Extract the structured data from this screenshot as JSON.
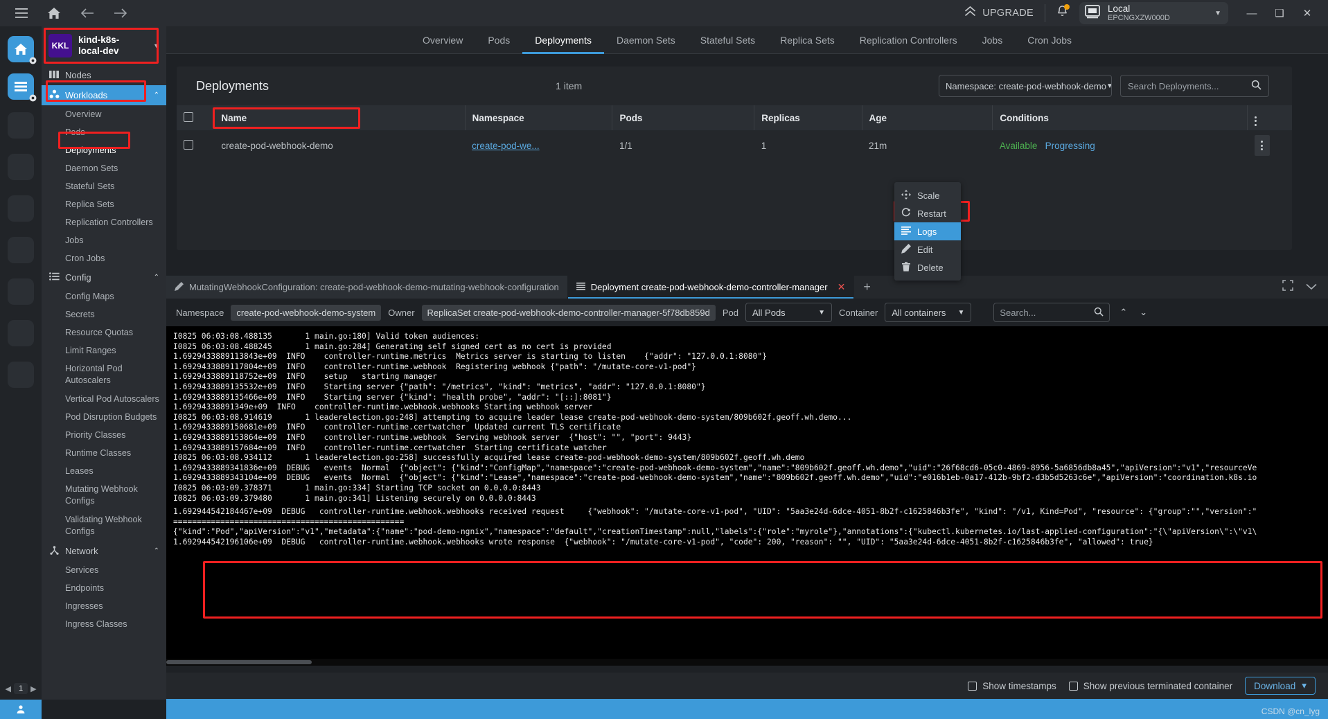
{
  "window": {
    "upgrade_label": "UPGRADE",
    "cluster_pill": {
      "name": "Local",
      "subtitle": "EPCNGXZW000D"
    },
    "controls": {
      "minimize": "—",
      "maximize": "❑",
      "close": "✕"
    }
  },
  "rail": {
    "page_number": "1",
    "prev": "◀",
    "next": "▶"
  },
  "sidebar": {
    "context": {
      "badge": "KKL",
      "name": "kind-k8s-local-dev"
    },
    "items": [
      {
        "label": "Nodes",
        "type": "group",
        "icon": "nodes-icon"
      },
      {
        "label": "Workloads",
        "type": "group",
        "icon": "workloads-icon",
        "selected": true,
        "chevron": "⌃"
      },
      {
        "label": "Overview",
        "type": "item"
      },
      {
        "label": "Pods",
        "type": "item"
      },
      {
        "label": "Deployments",
        "type": "item",
        "highlighted": true
      },
      {
        "label": "Daemon Sets",
        "type": "item"
      },
      {
        "label": "Stateful Sets",
        "type": "item"
      },
      {
        "label": "Replica Sets",
        "type": "item"
      },
      {
        "label": "Replication Controllers",
        "type": "item"
      },
      {
        "label": "Jobs",
        "type": "item"
      },
      {
        "label": "Cron Jobs",
        "type": "item"
      },
      {
        "label": "Config",
        "type": "group",
        "icon": "config-icon",
        "chevron": "⌃"
      },
      {
        "label": "Config Maps",
        "type": "item"
      },
      {
        "label": "Secrets",
        "type": "item"
      },
      {
        "label": "Resource Quotas",
        "type": "item"
      },
      {
        "label": "Limit Ranges",
        "type": "item"
      },
      {
        "label": "Horizontal Pod Autoscalers",
        "type": "item",
        "two_line": true
      },
      {
        "label": "Vertical Pod Autoscalers",
        "type": "item"
      },
      {
        "label": "Pod Disruption Budgets",
        "type": "item"
      },
      {
        "label": "Priority Classes",
        "type": "item"
      },
      {
        "label": "Runtime Classes",
        "type": "item"
      },
      {
        "label": "Leases",
        "type": "item"
      },
      {
        "label": "Mutating Webhook Configs",
        "type": "item",
        "two_line": true
      },
      {
        "label": "Validating Webhook Configs",
        "type": "item",
        "two_line": true
      },
      {
        "label": "Network",
        "type": "group",
        "icon": "network-icon",
        "chevron": "⌃"
      },
      {
        "label": "Services",
        "type": "item"
      },
      {
        "label": "Endpoints",
        "type": "item"
      },
      {
        "label": "Ingresses",
        "type": "item"
      },
      {
        "label": "Ingress Classes",
        "type": "item"
      }
    ]
  },
  "top_tabs": [
    {
      "label": "Overview",
      "active": false
    },
    {
      "label": "Pods",
      "active": false
    },
    {
      "label": "Deployments",
      "active": true
    },
    {
      "label": "Daemon Sets",
      "active": false
    },
    {
      "label": "Stateful Sets",
      "active": false
    },
    {
      "label": "Replica Sets",
      "active": false
    },
    {
      "label": "Replication Controllers",
      "active": false
    },
    {
      "label": "Jobs",
      "active": false
    },
    {
      "label": "Cron Jobs",
      "active": false
    }
  ],
  "deployments_card": {
    "title": "Deployments",
    "count": "1 item",
    "namespace_select": "Namespace: create-pod-webhook-demo",
    "search_placeholder": "Search Deployments...",
    "columns": [
      "Name",
      "Namespace",
      "Pods",
      "Replicas",
      "Age",
      "Conditions"
    ],
    "rows": [
      {
        "name": "create-pod-webhook-demo",
        "namespace": "create-pod-we...",
        "pods": "1/1",
        "replicas": "1",
        "age": "21m",
        "condition_available": "Available",
        "condition_progressing": "Progressing"
      }
    ]
  },
  "context_menu": {
    "items": [
      {
        "label": "Scale",
        "icon": "move-icon",
        "highlighted": false
      },
      {
        "label": "Restart",
        "icon": "restart-icon",
        "highlighted": false
      },
      {
        "label": "Logs",
        "icon": "logs-icon",
        "highlighted": true
      },
      {
        "label": "Edit",
        "icon": "pencil-icon",
        "highlighted": false
      },
      {
        "label": "Delete",
        "icon": "trash-icon",
        "highlighted": false
      }
    ]
  },
  "log_panel": {
    "tabs": [
      {
        "label": "MutatingWebhookConfiguration: create-pod-webhook-demo-mutating-webhook-configuration",
        "icon": "pencil-icon",
        "active": false
      },
      {
        "label": "Deployment create-pod-webhook-demo-controller-manager",
        "icon": "logs-icon",
        "active": true,
        "close": "✕"
      }
    ],
    "add_tab": "+",
    "expand_icon": "expand-icon",
    "chevron_icon": "chevron-down-icon",
    "filters": {
      "namespace_label": "Namespace",
      "namespace_value": "create-pod-webhook-demo-system",
      "owner_label": "Owner",
      "owner_value": "ReplicaSet create-pod-webhook-demo-controller-manager-5f78db859d",
      "pod_label": "Pod",
      "pod_value": "All Pods",
      "container_label": "Container",
      "container_value": "All containers",
      "search_placeholder": "Search...",
      "up_arrow": "⌃",
      "down_arrow": "⌄"
    },
    "log_lines_top": "I0825 06:03:08.488135       1 main.go:180] Valid token audiences:\nI0825 06:03:08.488245       1 main.go:284] Generating self signed cert as no cert is provided\n1.6929433889113843e+09  INFO    controller-runtime.metrics  Metrics server is starting to listen    {\"addr\": \"127.0.0.1:8080\"}\n1.6929433889117804e+09  INFO    controller-runtime.webhook  Registering webhook {\"path\": \"/mutate-core-v1-pod\"}\n1.6929433889118752e+09  INFO    setup   starting manager\n1.6929433889135532e+09  INFO    Starting server {\"path\": \"/metrics\", \"kind\": \"metrics\", \"addr\": \"127.0.0.1:8080\"}\n1.6929433889135466e+09  INFO    Starting server {\"kind\": \"health probe\", \"addr\": \"[::]:8081\"}\n1.69294338891349e+09  INFO    controller-runtime.webhook.webhooks Starting webhook server\nI0825 06:03:08.914619       1 leaderelection.go:248] attempting to acquire leader lease create-pod-webhook-demo-system/809b602f.geoff.wh.demo...\n1.6929433889150681e+09  INFO    controller-runtime.certwatcher  Updated current TLS certificate\n1.6929433889153864e+09  INFO    controller-runtime.webhook  Serving webhook server  {\"host\": \"\", \"port\": 9443}\n1.6929433889157684e+09  INFO    controller-runtime.certwatcher  Starting certificate watcher\nI0825 06:03:08.934112       1 leaderelection.go:258] successfully acquired lease create-pod-webhook-demo-system/809b602f.geoff.wh.demo\n1.6929433889341836e+09  DEBUG   events  Normal  {\"object\": {\"kind\":\"ConfigMap\",\"namespace\":\"create-pod-webhook-demo-system\",\"name\":\"809b602f.geoff.wh.demo\",\"uid\":\"26f68cd6-05c0-4869-8956-5a6856db8a45\",\"apiVersion\":\"v1\",\"resourceVe\n1.6929433889343104e+09  DEBUG   events  Normal  {\"object\": {\"kind\":\"Lease\",\"namespace\":\"create-pod-webhook-demo-system\",\"name\":\"809b602f.geoff.wh.demo\",\"uid\":\"e016b1eb-0a17-412b-9bf2-d3b5d5263c6e\",\"apiVersion\":\"coordination.k8s.io\nI0825 06:03:09.378371       1 main.go:334] Starting TCP socket on 0.0.0.0:8443\nI0825 06:03:09.379480       1 main.go:341] Listening securely on 0.0.0.0:8443",
    "log_lines_highlight": "1.692944542184467e+09  DEBUG   controller-runtime.webhook.webhooks received request     {\"webhook\": \"/mutate-core-v1-pod\", \"UID\": \"5aa3e24d-6dce-4051-8b2f-c1625846b3fe\", \"kind\": \"/v1, Kind=Pod\", \"resource\": {\"group\":\"\",\"version\":\"\n=================================================\n{\"kind\":\"Pod\",\"apiVersion\":\"v1\",\"metadata\":{\"name\":\"pod-demo-ngnix\",\"namespace\":\"default\",\"creationTimestamp\":null,\"labels\":{\"role\":\"myrole\"},\"annotations\":{\"kubectl.kubernetes.io/last-applied-configuration\":\"{\\\"apiVersion\\\":\\\"v1\\\n1.692944542196106e+09  DEBUG   controller-runtime.webhook.webhooks wrote response  {\"webhook\": \"/mutate-core-v1-pod\", \"code\": 200, \"reason\": \"\", \"UID\": \"5aa3e24d-6dce-4051-8b2f-c1625846b3fe\", \"allowed\": true}",
    "footer": {
      "show_timestamps": "Show timestamps",
      "show_previous": "Show previous terminated container",
      "download": "Download",
      "download_caret": "▾"
    }
  },
  "watermark": "CSDN @cn_lyg"
}
